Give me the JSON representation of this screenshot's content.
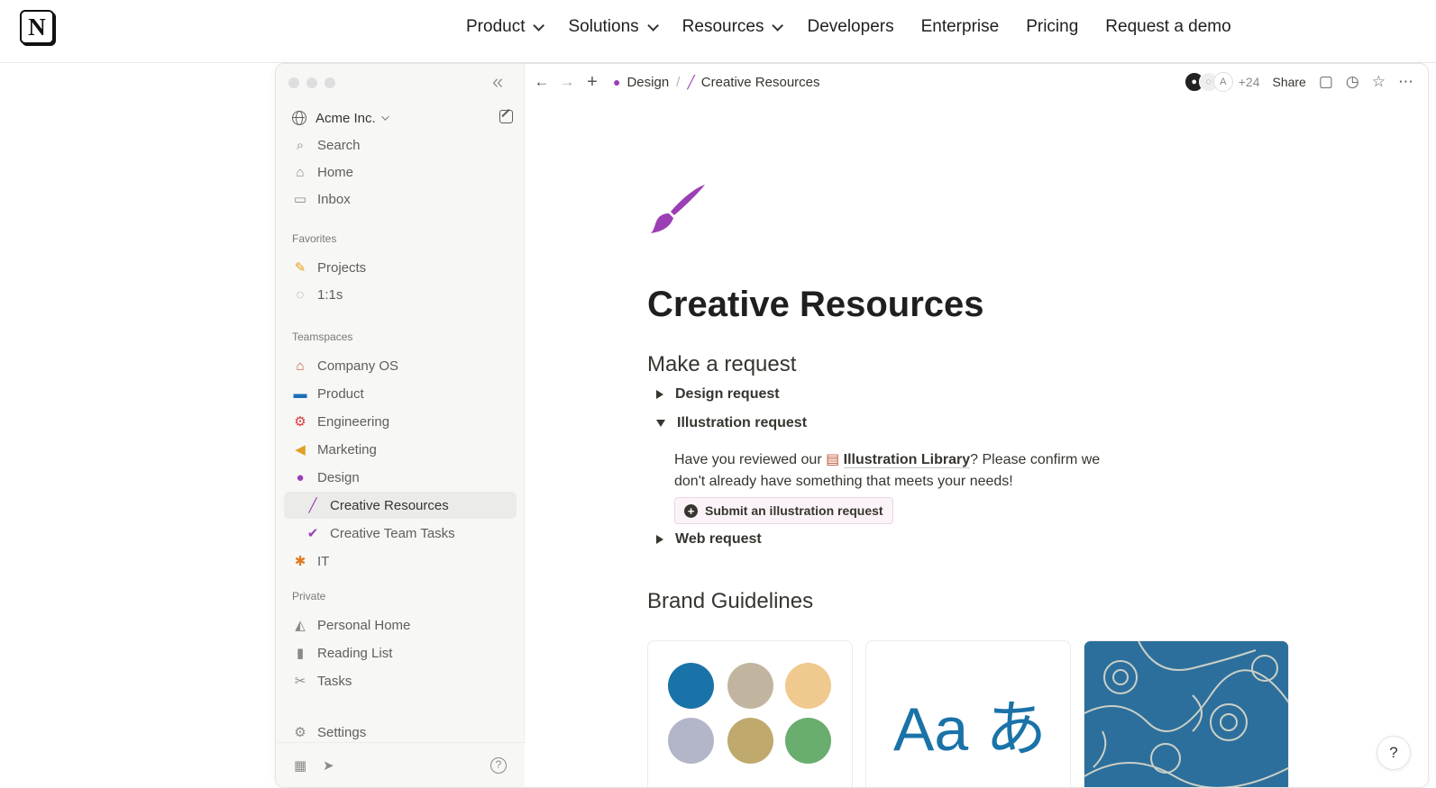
{
  "site_nav": {
    "logo": "N",
    "links": [
      {
        "label": "Product",
        "has_dropdown": true
      },
      {
        "label": "Solutions",
        "has_dropdown": true
      },
      {
        "label": "Resources",
        "has_dropdown": true
      },
      {
        "label": "Developers",
        "has_dropdown": false
      },
      {
        "label": "Enterprise",
        "has_dropdown": false
      },
      {
        "label": "Pricing",
        "has_dropdown": false
      },
      {
        "label": "Request a demo",
        "has_dropdown": false
      }
    ]
  },
  "sidebar": {
    "workspace": "Acme Inc.",
    "top_items": [
      {
        "label": "Search",
        "icon": "search-icon"
      },
      {
        "label": "Home",
        "icon": "home-icon"
      },
      {
        "label": "Inbox",
        "icon": "inbox-icon"
      }
    ],
    "favorites_heading": "Favorites",
    "favorites": [
      {
        "label": "Projects",
        "icon": "pencil-icon"
      },
      {
        "label": "1:1s",
        "icon": "speech-bubble-icon"
      }
    ],
    "teamspaces_heading": "Teamspaces",
    "teamspaces": [
      {
        "label": "Company OS",
        "icon": "house-icon"
      },
      {
        "label": "Product",
        "icon": "laptop-icon"
      },
      {
        "label": "Engineering",
        "icon": "gear-icon"
      },
      {
        "label": "Marketing",
        "icon": "megaphone-icon"
      },
      {
        "label": "Design",
        "icon": "palette-icon"
      },
      {
        "label": "Creative Resources",
        "icon": "paintbrush-icon",
        "active": true,
        "sub": true
      },
      {
        "label": "Creative Team Tasks",
        "icon": "check-circle-icon",
        "sub": true
      },
      {
        "label": "IT",
        "icon": "bug-icon"
      }
    ],
    "private_heading": "Private",
    "private": [
      {
        "label": "Personal Home",
        "icon": "pizza-icon"
      },
      {
        "label": "Reading List",
        "icon": "book-icon"
      },
      {
        "label": "Tasks",
        "icon": "scissors-icon"
      }
    ],
    "settings": "Settings"
  },
  "page_bar": {
    "breadcrumbs": [
      {
        "label": "Design",
        "icon": "palette-icon"
      },
      {
        "label": "Creative Resources",
        "icon": "paintbrush-icon"
      }
    ],
    "avatar_more": "+24",
    "avatar_letter": "A",
    "share": "Share"
  },
  "page": {
    "title": "Creative Resources",
    "section1": "Make a request",
    "toggles": [
      {
        "label": "Design request",
        "open": false
      },
      {
        "label": "Illustration request",
        "open": true
      },
      {
        "label": "Web request",
        "open": false
      }
    ],
    "illustration_text_before": "Have you reviewed our ",
    "illustration_link": "Illustration Library",
    "illustration_text_after": "? Please confirm we don't already have something that meets your needs!",
    "submit_button": "Submit an illustration request",
    "section2": "Brand Guidelines",
    "typography_sample": "Aa あ"
  },
  "colors": {
    "accent_purple": "#9b3fb5",
    "swatches": [
      "#1a73a8",
      "#c2b59f",
      "#f0c98e",
      "#b3b6c8",
      "#bfa96d",
      "#69ad6f"
    ]
  }
}
